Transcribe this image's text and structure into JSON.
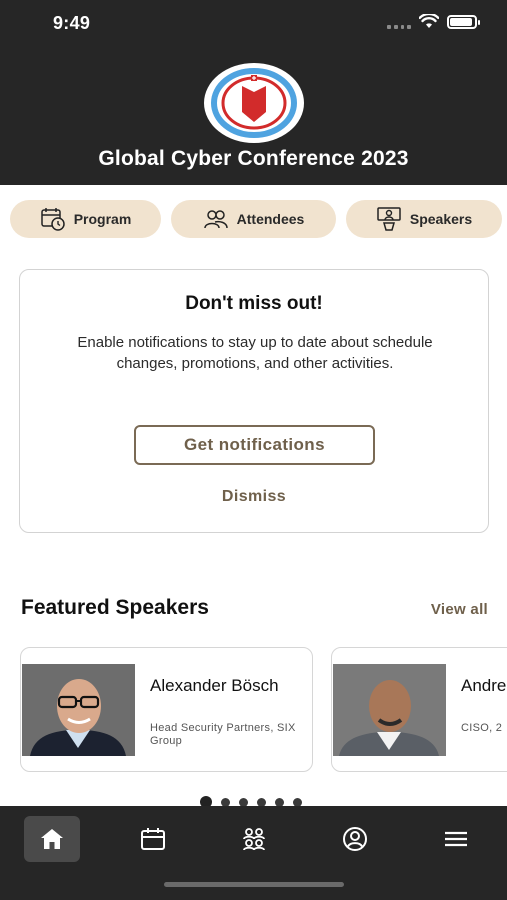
{
  "status_bar": {
    "time": "9:49"
  },
  "header": {
    "title": "Global Cyber Conference 2023"
  },
  "quick_links": [
    {
      "label": "Program",
      "icon": "calendar-clock-icon"
    },
    {
      "label": "Attendees",
      "icon": "people-icon"
    },
    {
      "label": "Speakers",
      "icon": "speaker-podium-icon"
    }
  ],
  "notification_card": {
    "title": "Don't miss out!",
    "body": "Enable notifications to stay up to date about schedule changes, promotions, and other activities.",
    "primary_button": "Get notifications",
    "secondary_button": "Dismiss"
  },
  "featured_speakers": {
    "title": "Featured Speakers",
    "view_all": "View all",
    "speakers": [
      {
        "name": "Alexander Bösch",
        "role": "Head Security Partners, SIX Group"
      },
      {
        "name": "Andre",
        "role": "CISO, 2"
      }
    ],
    "carousel": {
      "pages": 6,
      "active_index": 0
    }
  },
  "bottom_nav": {
    "items": [
      {
        "name": "home",
        "icon": "home-icon",
        "active": true
      },
      {
        "name": "calendar",
        "icon": "calendar-icon",
        "active": false
      },
      {
        "name": "attendees",
        "icon": "people-icon",
        "active": false
      },
      {
        "name": "profile",
        "icon": "profile-icon",
        "active": false
      },
      {
        "name": "menu",
        "icon": "menu-icon",
        "active": false
      }
    ]
  },
  "colors": {
    "header_bg": "#262626",
    "pill_bg": "#f1e3cf",
    "accent_brown": "#6f604b",
    "logo_red": "#d22b2b",
    "logo_blue": "#4fa3e0"
  }
}
